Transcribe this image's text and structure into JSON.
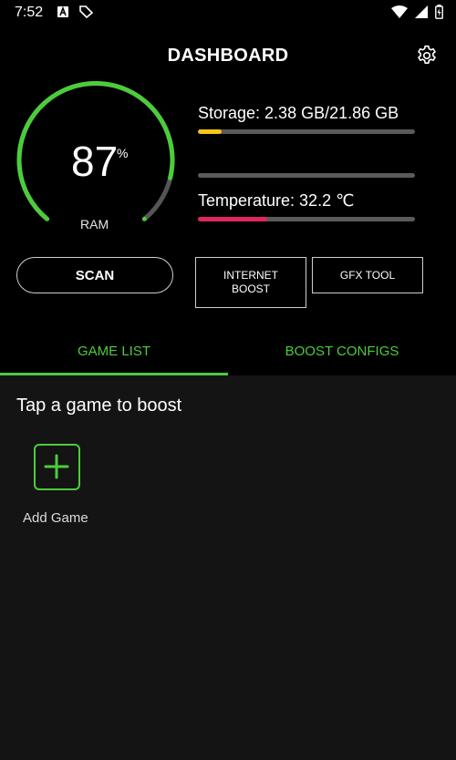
{
  "status_bar": {
    "time": "7:52"
  },
  "header": {
    "title": "DASHBOARD"
  },
  "gauge": {
    "value": "87",
    "unit": "%",
    "label": "RAM",
    "level": 0.87
  },
  "storage": {
    "label": "Storage: 2.38 GB/21.86 GB",
    "fraction": 0.11,
    "color": "#f5c518"
  },
  "middle_bar": {
    "fraction": 0.0
  },
  "temperature": {
    "label": "Temperature: 32.2 ℃",
    "fraction": 0.32,
    "color": "#e2265d"
  },
  "buttons": {
    "scan": "SCAN",
    "internet_line1": "INTERNET",
    "internet_line2": "BOOST",
    "gfx": "GFX TOOL"
  },
  "tabs": [
    {
      "label": "GAME LIST",
      "selected": true
    },
    {
      "label": "BOOST CONFIGS",
      "selected": false
    }
  ],
  "game_list": {
    "hint": "Tap a game to boost",
    "add_label": "Add Game"
  },
  "colors": {
    "accent": "#4ccc3c",
    "background": "#141414",
    "header": "#000000"
  }
}
